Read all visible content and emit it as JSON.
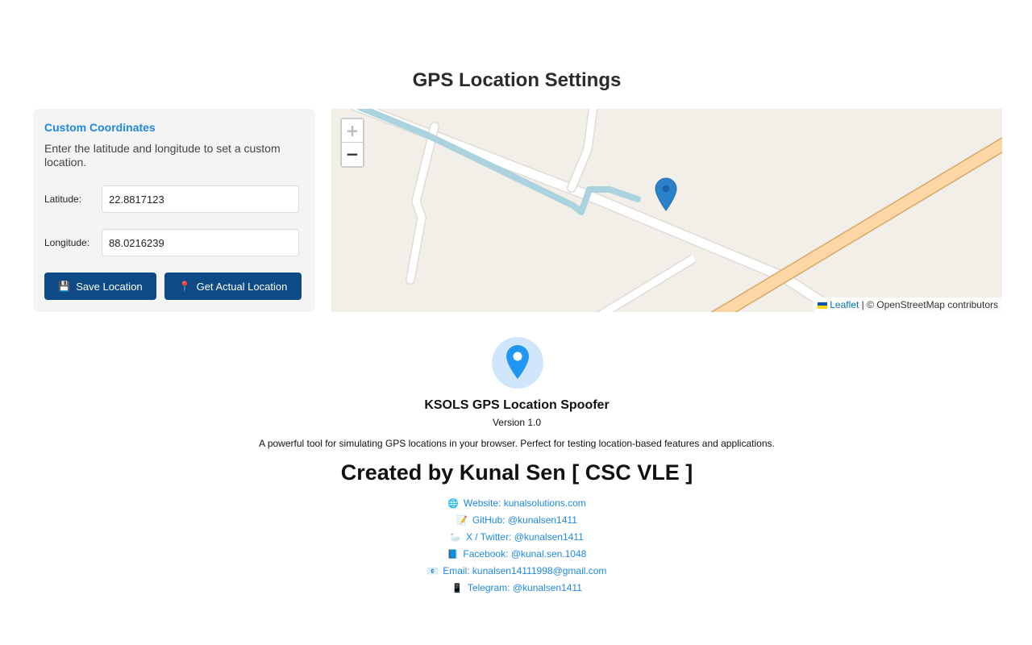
{
  "page": {
    "title": "GPS Location Settings"
  },
  "custom": {
    "heading": "Custom Coordinates",
    "description": "Enter the latitude and longitude to set a custom location.",
    "latitude_label": "Latitude:",
    "latitude_value": "22.8817123",
    "longitude_label": "Longitude:",
    "longitude_value": "88.0216239",
    "save_icon": "💾",
    "save_label": "Save Location",
    "actual_icon": "📍",
    "actual_label": "Get Actual Location"
  },
  "map": {
    "zoom_in": "+",
    "zoom_out": "−",
    "attribution_link": "Leaflet",
    "attribution_text": " | © OpenStreetMap contributors",
    "colors": {
      "land": "#f2efe9",
      "road": "#ffffff",
      "water": "#aad3df",
      "highway": "#fcd6a4",
      "marker": "#2a81cb"
    }
  },
  "about": {
    "icon": "location-pin-icon",
    "app_name": "KSOLS GPS Location Spoofer",
    "version": "Version 1.0",
    "tagline": "A powerful tool for simulating GPS locations in your browser. Perfect for testing location-based features and applications.",
    "creator": "Created by Kunal Sen [ CSC VLE ]",
    "links": [
      {
        "icon": "🌐",
        "text": "Website: kunalsolutions.com"
      },
      {
        "icon": "📝",
        "text": "GitHub: @kunalsen1411"
      },
      {
        "icon": "🦢",
        "text": "X / Twitter: @kunalsen1411"
      },
      {
        "icon": "📘",
        "text": "Facebook: @kunal.sen.1048"
      },
      {
        "icon": "📧",
        "text": "Email: kunalsen14111998@gmail.com"
      },
      {
        "icon": "📱",
        "text": "Telegram: @kunalsen1411"
      }
    ]
  }
}
